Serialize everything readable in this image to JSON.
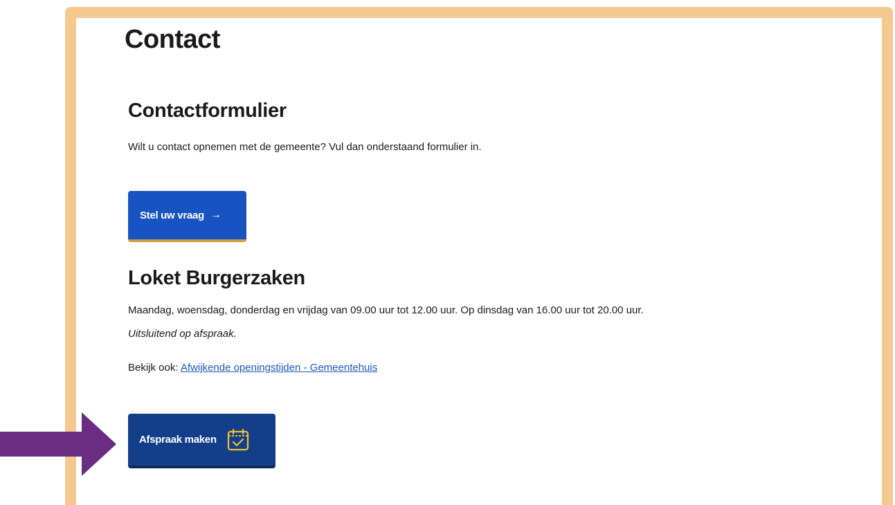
{
  "page": {
    "title": "Contact"
  },
  "contact_form": {
    "heading": "Contactformulier",
    "intro": "Wilt u contact opnemen met de gemeente? Vul dan onderstaand formulier in.",
    "button_label": "Stel uw vraag",
    "button_arrow": "→"
  },
  "loket": {
    "heading": "Loket Burgerzaken",
    "hours_text": "Maandag, woensdag, donderdag en vrijdag van 09.00 uur tot 12.00 uur. Op dinsdag van 16.00 uur tot 20.00 uur. ",
    "hours_note": "Uitsluitend op afspraak.",
    "see_also_prefix": "Bekijk ook: ",
    "see_also_link": "Afwijkende openingstijden - Gemeentehuis",
    "appointment_button_label": "Afspraak maken",
    "appointment_icon": "calendar-check-icon"
  },
  "colors": {
    "frame": "#f4c88f",
    "button_primary": "#1754c2",
    "button_dark": "#133f8a",
    "button_accent": "#d19a3a",
    "link": "#1b59b8",
    "annotation_arrow": "#6b2d82",
    "icon_yellow": "#f2c230"
  }
}
